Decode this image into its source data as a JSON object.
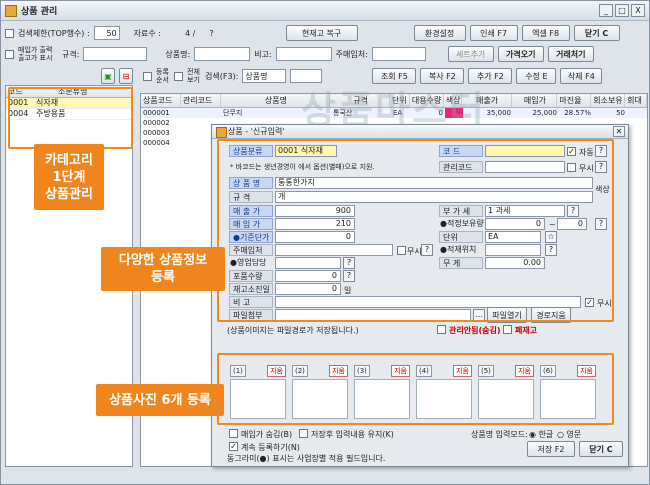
{
  "window": {
    "title": "상품 관리",
    "controls": [
      "_",
      "□",
      "X"
    ]
  },
  "toolbar1": {
    "search_limit_label": "검색제한(TOP행수) :",
    "search_limit_value": "50",
    "material_count_label": "자료수 :",
    "material_count_value": "4 /",
    "material_total": "?",
    "restore_button": "현재고 복구",
    "env_button": "환경설정",
    "print_button": "인쇄 F7",
    "excel_button": "엑셀 F8",
    "close_button": "닫기 C"
  },
  "toolbar2": {
    "buy_price_label": "매입가 출력",
    "sale_price_label": "출고가 표시",
    "spec_label": "규격:",
    "product_label": "상품명:",
    "note_label": "비고:",
    "main_supplier_label": "주매입처:",
    "add_button": "세트추가",
    "price_button": "가격오기",
    "base_button": "거래처기"
  },
  "toolbar3": {
    "search_f3_label": "검색(F3):",
    "search_f3_value": "상품명",
    "query_button": "조회 F5",
    "copy_button": "복사 F2",
    "add_button": "추가 F2",
    "edit_button": "수정 E",
    "delete_button": "삭제 F4",
    "chk1": "등록 순서",
    "chk2": "전체 보기"
  },
  "watermark": "상품마스터",
  "left_table": {
    "columns": [
      "코드",
      "소분류명"
    ],
    "rows": [
      {
        "code": "0001",
        "name": "식자재",
        "selected": true
      },
      {
        "code": "0004",
        "name": "주방용품",
        "selected": false
      }
    ]
  },
  "grid": {
    "columns": [
      "상품코드",
      "관리코드",
      "상품명",
      "규격",
      "단위",
      "대용수량",
      "색상",
      "매출가",
      "매입가",
      "마진율",
      "회소보유",
      "회대"
    ],
    "rows": [
      {
        "code": "000001",
        "mgmt": "",
        "name": "단무지",
        "spec": "통국산",
        "unit": "EA",
        "qty": "0",
        "color": "",
        "sale": "35,000",
        "buy": "25,000",
        "margin": "28.57%",
        "hold": "50"
      },
      {
        "code": "000002",
        "mgmt": "",
        "name": "",
        "spec": "",
        "unit": "",
        "qty": "",
        "color": "",
        "sale": "",
        "buy": "",
        "margin": "",
        "hold": ""
      },
      {
        "code": "000003",
        "mgmt": "",
        "name": "",
        "spec": "",
        "unit": "",
        "qty": "",
        "color": "",
        "sale": "",
        "buy": "",
        "margin": "",
        "hold": ""
      },
      {
        "code": "000004",
        "mgmt": "",
        "name": "",
        "spec": "",
        "unit": "",
        "qty": "",
        "color": "",
        "sale": "",
        "buy": "",
        "margin": "",
        "hold": ""
      }
    ]
  },
  "dialog": {
    "title": "상품 - '신규입력'",
    "category_label": "상품분류",
    "category_value": "0001 식자재",
    "code_label": "코 드",
    "auto_label": "자동",
    "barcode_note": "* 바코드는 생년경영이 에서 옵션(별매)으로 지원.",
    "mgmt_code_label": "관리코드",
    "ignore_label": "무시",
    "name_label": "상 품 명",
    "name_value": "통통한가지",
    "color_label": "색상",
    "spec_label": "규 격",
    "spec_value": "개",
    "sale_label": "매 출 가",
    "sale_value": "900",
    "vat_label": "부 가 세",
    "vat_value": "1 과세",
    "buy_label": "매 입 가",
    "buy_value": "210",
    "stock_label": "●적정보유량",
    "stock_value": "0",
    "stock_value2": "0",
    "base_label": "●기준단가",
    "base_value": "0",
    "unit_label": "단위",
    "unit_value": "EA",
    "supplier_label": "주매입처",
    "loc_label": "●적재위치",
    "manager_label": "●영업담당",
    "weight_label": "무 게",
    "weight_value": "0.00",
    "item_qty_label": "포품수량",
    "item_qty_value": "0",
    "stock_days_label": "재고소진일",
    "stock_days_value": "0",
    "days_unit": "일",
    "note_label": "비 고",
    "file_label": "파일첨부",
    "file_open": "파일열기",
    "path_ignore": "경로지움",
    "file_note": "(상품이미지는 파일경로가 저장됩니다.)",
    "manage_group": "관리안됨(숨김)",
    "discount": "폐재고",
    "photos": [
      "(1)",
      "(2)",
      "(3)",
      "(4)",
      "(5)",
      "(6)"
    ],
    "photo_delete": "지움",
    "buy_input_label": "매입가 숨김(B)",
    "memo_label": "저장후 입력내용 유지(K)",
    "lang_label": "상품명 입력모드:",
    "lang_korean": "한글",
    "lang_english": "영문",
    "continue_label": "계속 등록하기(N)",
    "legend_note": "동그라미(●) 표시는 사업장별 적용 필드입니다.",
    "save_button": "저장 F2",
    "close_button": "닫기 C"
  },
  "annotations": {
    "callout1": "카테고리\n1단계\n상품관리",
    "callout2": "다양한 상품정보\n등록",
    "callout3": "상품사진 6개 등록"
  },
  "colors": {
    "accent": "#f08a1c",
    "dialog_label": "#c8d8f4",
    "yellow": "#fff7b0"
  }
}
